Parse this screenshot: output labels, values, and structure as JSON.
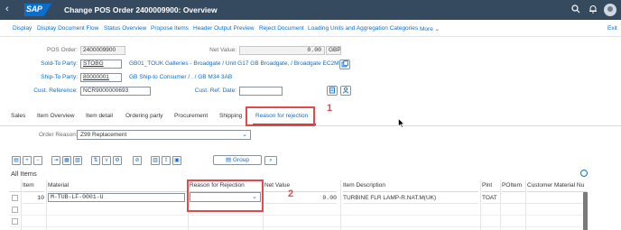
{
  "shell": {
    "back_glyph": "‹",
    "logo_text": "SAP",
    "title": "Change POS Order 2400009900: Overview"
  },
  "toolbar": {
    "items": [
      "Display",
      "Display Document Flow",
      "Status Overview",
      "Propose Items",
      "Header Output Preview",
      "Reject Document",
      "Loading Units and Aggregation Categories",
      "More"
    ],
    "more_chevron": "⌄",
    "exit": "Exit"
  },
  "header": {
    "pos_order_label": "POS Order:",
    "pos_order_value": "2400009900",
    "net_value_label": "Net Value:",
    "net_value": "0.00",
    "currency": "GBP",
    "sold_to_label": "Sold-To Party:",
    "sold_to_value": "STOBG",
    "sold_to_desc": "GB01_TOUK Galleries - Broadgate / Unit G17 GB Broadgate, / Broadgate EC2M...",
    "ship_to_label": "Ship-To Party:",
    "ship_to_value": "80000001",
    "ship_to_desc": "GB Ship-to Consumer / . / GB M34 3AB",
    "cust_ref_label": "Cust. Reference:",
    "cust_ref_value": "NCR9000000693",
    "cust_ref_date_label": "Cust. Ref. Date:",
    "cust_ref_date_value": ""
  },
  "tabs": [
    "Sales",
    "Item Overview",
    "Item detail",
    "Ordering party",
    "Procurement",
    "Shipping",
    "Reason for rejection"
  ],
  "markers": {
    "m1": "1",
    "m2": "2"
  },
  "order_reason": {
    "label": "Order Reason:",
    "value": "Z99 Replacement"
  },
  "table_toolbar": {
    "group_label": "Group"
  },
  "items_section": {
    "title": "All Items"
  },
  "grid": {
    "columns": [
      "Item",
      "Material",
      "Reason for Rejection",
      "Net Value",
      "Item Description",
      "Plnt",
      "POItem",
      "Customer Material Nu"
    ],
    "rows": [
      {
        "item": "10",
        "material": "M-TUB-LF-0001-U",
        "reason": "",
        "net_value": "0.00",
        "description": "TURBINE FLR LAMP-R.NAT.M(UK)",
        "plant": "TOAT",
        "po_item": "",
        "cust_material": ""
      }
    ]
  },
  "colors": {
    "shell": "#354a5f",
    "link": "#0a6ed1",
    "highlight": "#e04a4a"
  }
}
